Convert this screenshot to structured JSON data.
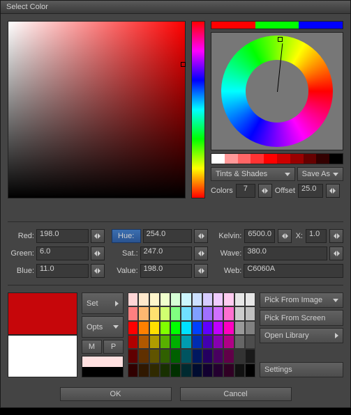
{
  "title": "Select Color",
  "rgbStrip": [
    "#ff0000",
    "#00ff00",
    "#0000ff"
  ],
  "tintsRow": [
    "#ffffff",
    "#ff9999",
    "#ff6666",
    "#ff3333",
    "#ff0000",
    "#cc0000",
    "#990000",
    "#660000",
    "#330000",
    "#000000"
  ],
  "dropdowns": {
    "tints": "Tints & Shades",
    "saveAs": "Save As"
  },
  "colorsOffset": {
    "colorsLabel": "Colors",
    "colors": "7",
    "offsetLabel": "Offset",
    "offset": "25.0"
  },
  "fields": {
    "red": {
      "label": "Red:",
      "value": "198.0"
    },
    "green": {
      "label": "Green:",
      "value": "6.0"
    },
    "blue": {
      "label": "Blue:",
      "value": "11.0"
    },
    "hue": {
      "label": "Hue:",
      "value": "254.0"
    },
    "sat": {
      "label": "Sat.:",
      "value": "247.0"
    },
    "val": {
      "label": "Value:",
      "value": "198.0"
    },
    "kelvin": {
      "label": "Kelvin:",
      "value": "6500.0"
    },
    "wave": {
      "label": "Wave:",
      "value": "380.0"
    },
    "web": {
      "label": "Web:",
      "value": "C6060A"
    },
    "x": {
      "label": "X:",
      "value": "1.0"
    }
  },
  "preview": {
    "top": "#c6060a",
    "bottom": "#ffffff"
  },
  "mid": {
    "set": "Set",
    "opts": "Opts",
    "m": "M",
    "p": "P",
    "sw1": "#ffe0e0",
    "sw2": "#000000"
  },
  "rightBtns": {
    "pickImage": "Pick From Image",
    "pickScreen": "Pick From Screen",
    "openLib": "Open Library",
    "settings": "Settings"
  },
  "footer": {
    "ok": "OK",
    "cancel": "Cancel"
  },
  "palette": [
    [
      "#ffd6d6",
      "#ffe8cc",
      "#fff6cc",
      "#f0ffcc",
      "#d6ffd6",
      "#ccf6ff",
      "#cce0ff",
      "#d6ccff",
      "#f0ccff",
      "#ffccf0",
      "#e6e6e6",
      "#e6e6e6"
    ],
    [
      "#ff8080",
      "#ffb870",
      "#ffe070",
      "#d0ff70",
      "#80ff80",
      "#70e0ff",
      "#80a0ff",
      "#a070ff",
      "#d070ff",
      "#ff70d0",
      "#cccccc",
      "#bfbfbf"
    ],
    [
      "#ff0000",
      "#ff8000",
      "#ffe000",
      "#80ff00",
      "#00ff00",
      "#00e0ff",
      "#0040ff",
      "#6000ff",
      "#c000ff",
      "#ff00c0",
      "#999999",
      "#808080"
    ],
    [
      "#b00000",
      "#b05800",
      "#b09c00",
      "#58b000",
      "#00b000",
      "#009cb0",
      "#002cb0",
      "#4300b0",
      "#8600b0",
      "#b00086",
      "#666666",
      "#4d4d4d"
    ],
    [
      "#600000",
      "#603000",
      "#605400",
      "#306000",
      "#006000",
      "#005460",
      "#001860",
      "#240060",
      "#480060",
      "#600048",
      "#333333",
      "#1a1a1a"
    ],
    [
      "#300000",
      "#301800",
      "#302a00",
      "#183000",
      "#003000",
      "#002a30",
      "#000c30",
      "#120030",
      "#240030",
      "#300024",
      "#111111",
      "#000000"
    ]
  ]
}
